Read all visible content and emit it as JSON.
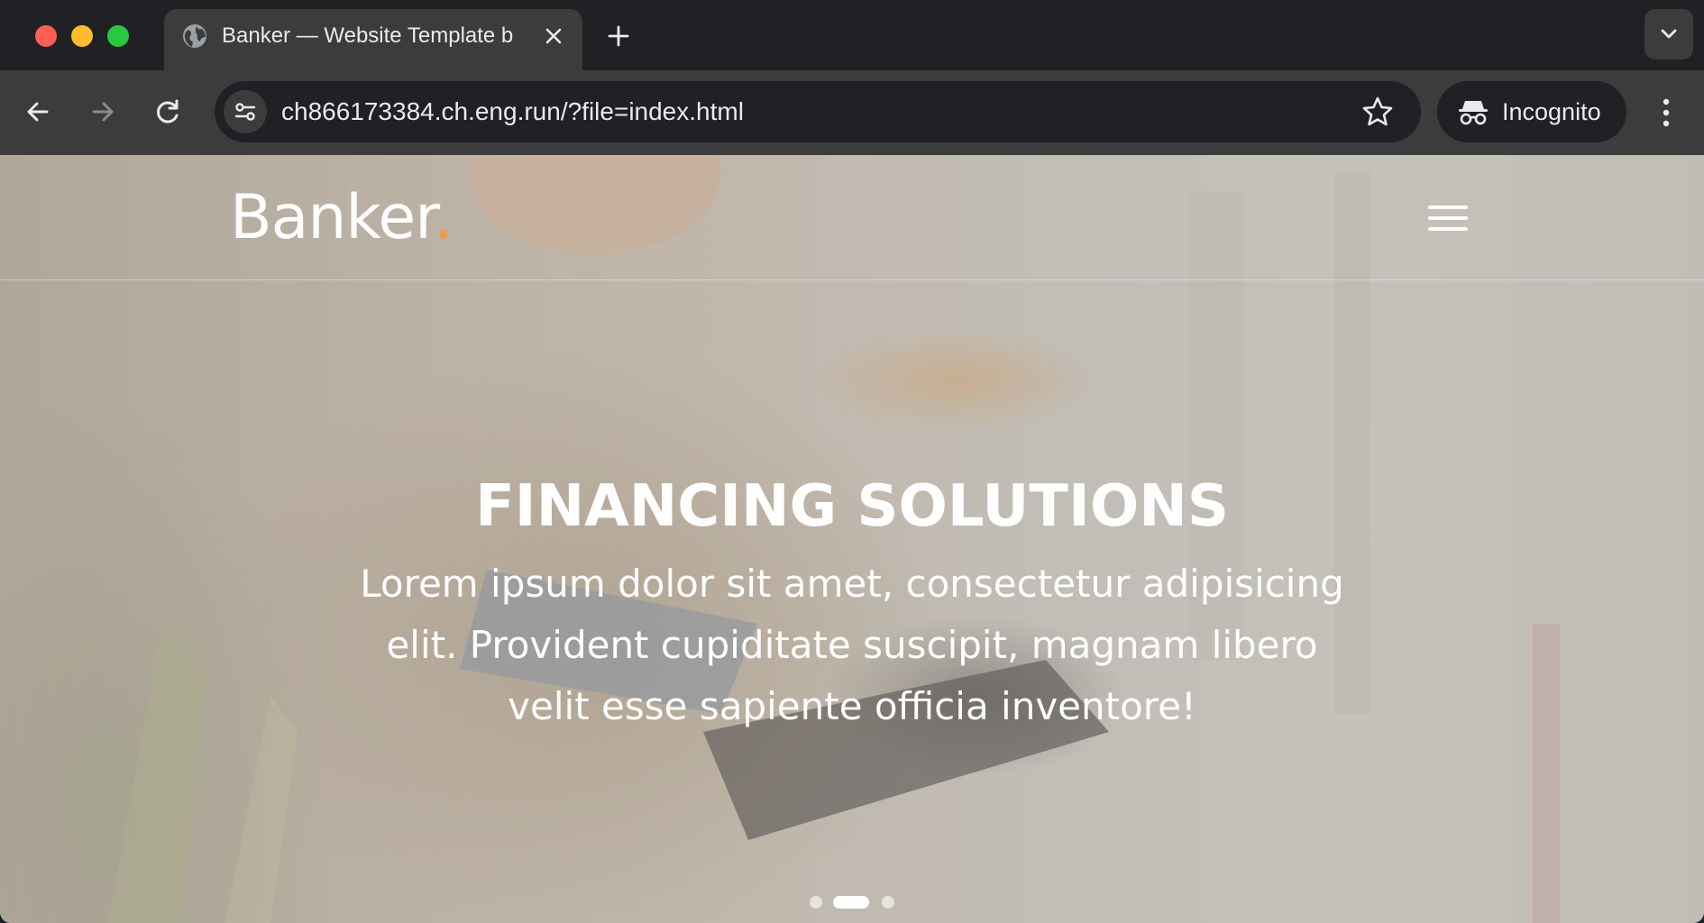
{
  "browser": {
    "tab_title": "Banker — Website Template b",
    "url": "ch866173384.ch.eng.run/?file=index.html",
    "incognito_label": "Incognito"
  },
  "site": {
    "logo_text": "Banker",
    "logo_dot": ".",
    "accent_color": "#f39c31"
  },
  "hero": {
    "title": "FINANCING SOLUTIONS",
    "subtitle": "Lorem ipsum dolor sit amet, consectetur adipisicing elit. Provident cupiditate suscipit, magnam libero velit esse sapiente officia inventore!",
    "slide_count": 3,
    "active_slide": 2
  },
  "icons": {
    "tab_favicon": "globe-icon",
    "tab_close": "close-icon",
    "new_tab": "plus-icon",
    "tab_search": "chevron-down-icon",
    "back": "arrow-left-icon",
    "forward": "arrow-right-icon",
    "reload": "reload-icon",
    "site_info": "tune-icon",
    "bookmark": "star-icon",
    "incognito": "incognito-icon",
    "menu": "kebab-icon",
    "site_menu": "hamburger-icon"
  }
}
